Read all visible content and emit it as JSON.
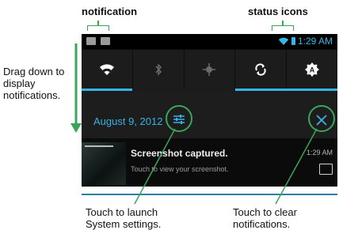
{
  "callouts": {
    "notification": "notification",
    "status_icons": "status icons",
    "drag": "Drag down to display notifications.",
    "settings": "Touch to launch System settings.",
    "clear": "Touch to clear notifications."
  },
  "status_bar": {
    "time": "1:29 AM",
    "left_icons": [
      "image-icon",
      "mail-icon"
    ],
    "right_icons": [
      "wifi-icon",
      "battery-icon"
    ],
    "accent": "#33b5e5"
  },
  "quick_settings": [
    {
      "icon": "wifi-icon",
      "active": true
    },
    {
      "icon": "bluetooth-icon",
      "active": false
    },
    {
      "icon": "gps-icon",
      "active": false
    },
    {
      "icon": "sync-icon",
      "active": true
    },
    {
      "icon": "auto-brightness-icon",
      "active": true
    }
  ],
  "header": {
    "date": "August 9, 2012",
    "settings_icon": "settings-sliders-icon",
    "clear_icon": "clear-x-icon"
  },
  "notification": {
    "title": "Screenshot captured.",
    "subtitle": "Touch to view your screenshot.",
    "time": "1:29 AM",
    "icon": "picture-icon"
  },
  "colors": {
    "callout_green": "#3aa55a",
    "date_blue": "#36b3e6"
  }
}
